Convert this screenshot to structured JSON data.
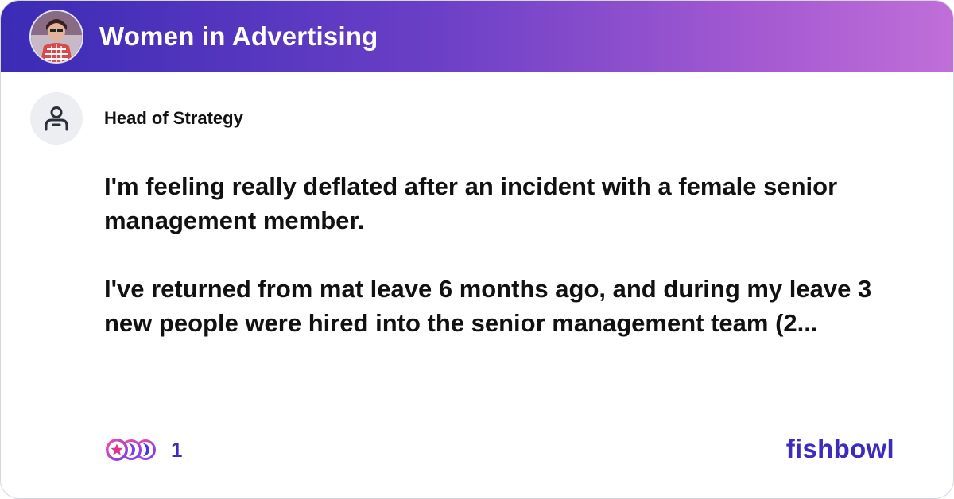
{
  "header": {
    "group_name": "Women in Advertising",
    "gradient_start": "#3b2bb5",
    "gradient_end": "#c06fd8",
    "group_avatar_icon": "group-photo-avatar"
  },
  "author": {
    "title": "Head of Strategy",
    "avatar_icon": "anonymous-user-icon"
  },
  "post": {
    "paragraph_1": "I'm feeling really deflated after an incident with a female senior management member.",
    "paragraph_2": "I've returned from mat leave 6 months ago, and during my leave 3 new people were hired into the senior management team (2..."
  },
  "reactions": {
    "icons": [
      "star-reaction-icon",
      "moon-reaction-icon",
      "moon-reaction-icon"
    ],
    "count": "1"
  },
  "brand": {
    "name": "fishbowl",
    "color": "#3d2bbf"
  }
}
